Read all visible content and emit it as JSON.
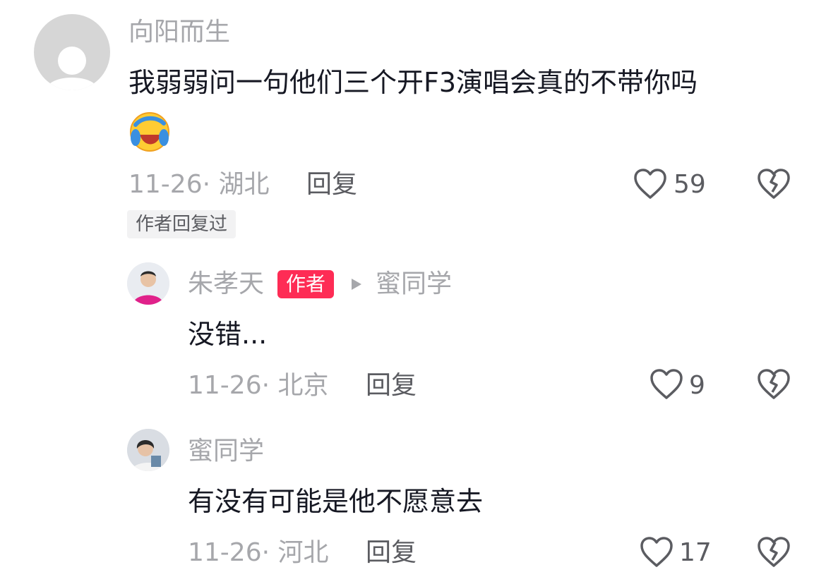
{
  "comments": [
    {
      "username": "向阳而生",
      "text": "我弱弱问一句他们三个开F3演唱会真的不带你吗",
      "emoji": "😂",
      "date_location": "11-26· 湖北",
      "reply_label": "回复",
      "likes": "59",
      "tag": "作者回复过"
    },
    {
      "username": "朱孝天",
      "badge": "作者",
      "reply_to": "蜜同学",
      "text": "没错...",
      "date_location": "11-26· 北京",
      "reply_label": "回复",
      "likes": "9"
    },
    {
      "username": "蜜同学",
      "text": "有没有可能是他不愿意去",
      "date_location": "11-26· 河北",
      "reply_label": "回复",
      "likes": "17"
    }
  ],
  "icons": {
    "like": "heart-outline-icon",
    "dislike": "broken-heart-icon",
    "reply_arrow": "play-triangle-icon"
  },
  "colors": {
    "author_badge": "#fe2c55",
    "muted_text": "#a6a7ab",
    "main_text": "#161823"
  }
}
